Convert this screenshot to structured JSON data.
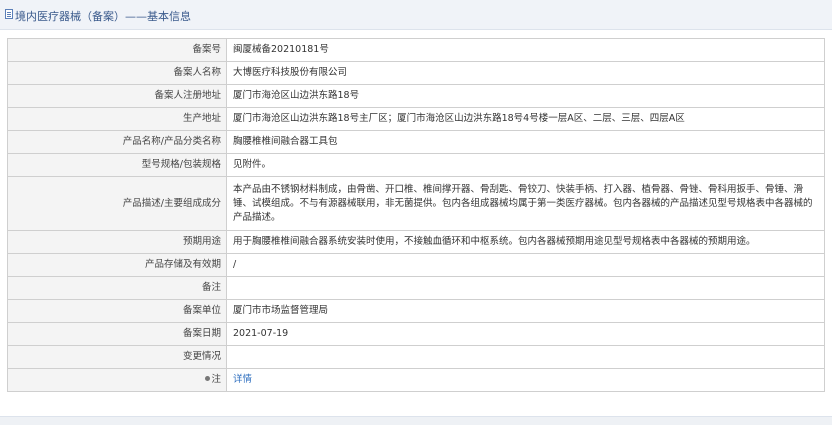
{
  "page": {
    "title": "境内医疗器械（备案）——基本信息"
  },
  "rows": [
    {
      "label": "备案号",
      "value": "闽厦械备20210181号"
    },
    {
      "label": "备案人名称",
      "value": "大博医疗科技股份有限公司"
    },
    {
      "label": "备案人注册地址",
      "value": "厦门市海沧区山边洪东路18号"
    },
    {
      "label": "生产地址",
      "value": "厦门市海沧区山边洪东路18号主厂区；厦门市海沧区山边洪东路18号4号楼一层A区、二层、三层、四层A区"
    },
    {
      "label": "产品名称/产品分类名称",
      "value": "胸腰椎椎间融合器工具包"
    },
    {
      "label": "型号规格/包装规格",
      "value": "见附件。"
    },
    {
      "label": "产品描述/主要组成成分",
      "value": "本产品由不锈钢材料制成，由骨凿、开口椎、椎间撑开器、骨刮匙、骨铰刀、快装手柄、打入器、植骨器、骨锉、骨科用扳手、骨锤、滑锤、试模组成。不与有源器械联用，非无菌提供。包内各组成器械均属于第一类医疗器械。包内各器械的产品描述见型号规格表中各器械的产品描述。"
    },
    {
      "label": "预期用途",
      "value": "用于胸腰椎椎间融合器系统安装时使用，不接触血循环和中枢系统。包内各器械预期用途见型号规格表中各器械的预期用途。"
    },
    {
      "label": "产品存储及有效期",
      "value": "/"
    },
    {
      "label": "备注",
      "value": ""
    },
    {
      "label": "备案单位",
      "value": "厦门市市场监督管理局"
    },
    {
      "label": "备案日期",
      "value": "2021-07-19"
    },
    {
      "label": "变更情况",
      "value": ""
    },
    {
      "label": "注",
      "value": "详情"
    }
  ]
}
